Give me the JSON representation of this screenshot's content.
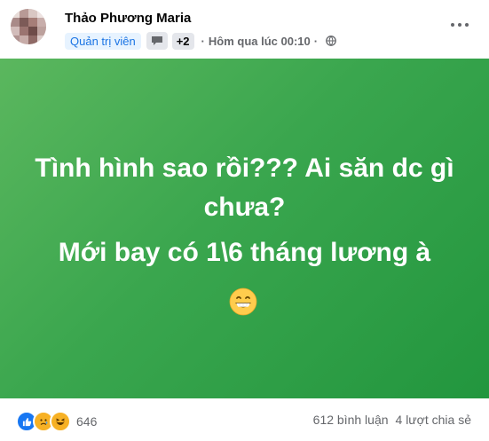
{
  "post": {
    "author": "Thảo Phương Maria",
    "role": "Quản trị viên",
    "badge_icon": "chat-badge-icon",
    "badge_count": "+2",
    "separator": "·",
    "time": "Hôm qua lúc 00:10",
    "privacy_icon": "globe-icon",
    "separator2": "·",
    "text_line1": "Tình hình sao rồi??? Ai săn dc gì chưa?",
    "text_line2": "Mới bay có 1\\6 tháng lương à",
    "emoji": "grinning-face-emoji"
  },
  "footer": {
    "reactions": [
      "like-icon",
      "sad-icon",
      "haha-icon"
    ],
    "reaction_count": "646",
    "comments": "612 bình luận",
    "shares": "4 lượt chia sẻ"
  },
  "colors": {
    "canvas_start": "#5bb75e",
    "canvas_end": "#22963e",
    "role_text": "#1b74e4",
    "muted": "#65676b"
  }
}
